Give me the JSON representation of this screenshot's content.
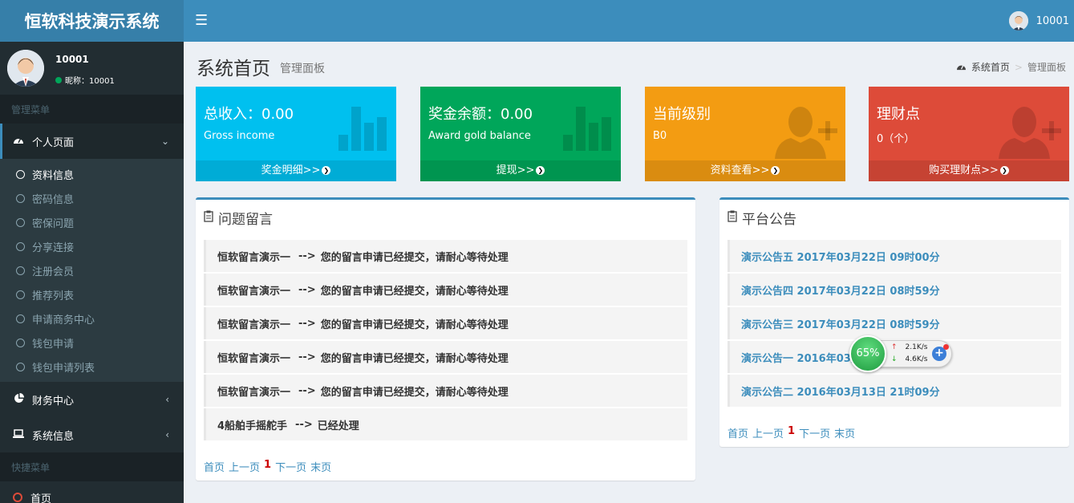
{
  "app": {
    "title": "恒软科技演示系统"
  },
  "topbar": {
    "username": "10001"
  },
  "user_panel": {
    "name": "10001",
    "nickname": "昵称：10001"
  },
  "sidebar": {
    "header_manage": "管理菜单",
    "personal": "个人页面",
    "sub_items": [
      "资料信息",
      "密码信息",
      "密保问题",
      "分享连接",
      "注册会员",
      "推荐列表",
      "申请商务中心",
      "钱包申请",
      "钱包申请列表"
    ],
    "finance": "财务中心",
    "system": "系统信息",
    "header_quick": "快捷菜单",
    "home": "首页"
  },
  "page": {
    "title": "系统首页",
    "subtitle": "管理面板"
  },
  "breadcrumb": {
    "home": "系统首页",
    "current": "管理面板"
  },
  "boxes": [
    {
      "title": "总收入：0.00",
      "sub": "Gross income",
      "link": "奖金明细>>",
      "color": "#00c0ef"
    },
    {
      "title": "奖金余额：0.00",
      "sub": "Award gold balance",
      "link": "提现>>",
      "color": "#00a65a"
    },
    {
      "title": "当前级别",
      "sub": "B0",
      "link": "资料查看>>",
      "color": "#f39c12"
    },
    {
      "title": "理财点",
      "sub": "0（个）",
      "link": "购买理财点>>",
      "color": "#dd4b39"
    }
  ],
  "messages": {
    "title": "问题留言",
    "rows": [
      {
        "name": "恒软留言演示一",
        "arrow": "-->",
        "text": "您的留言申请已经提交，请耐心等待处理"
      },
      {
        "name": "恒软留言演示一",
        "arrow": "-->",
        "text": "您的留言申请已经提交，请耐心等待处理"
      },
      {
        "name": "恒软留言演示一",
        "arrow": "-->",
        "text": "您的留言申请已经提交，请耐心等待处理"
      },
      {
        "name": "恒软留言演示一",
        "arrow": "-->",
        "text": "您的留言申请已经提交，请耐心等待处理"
      },
      {
        "name": "恒软留言演示一",
        "arrow": "-->",
        "text": "您的留言申请已经提交，请耐心等待处理"
      },
      {
        "name": "4船舶手摇舵手",
        "arrow": "-->",
        "text": "已经处理"
      }
    ]
  },
  "notices": {
    "title": "平台公告",
    "rows": [
      "演示公告五 2017年03月22日 09时00分",
      "演示公告四 2017年03月22日 08时59分",
      "演示公告三 2017年03月22日 08时59分",
      "演示公告一 2016年03月",
      "演示公告二 2016年03月13日 21时09分"
    ]
  },
  "pager": {
    "first": "首页",
    "prev": "上一页",
    "current": "1",
    "next": "下一页",
    "last": "末页"
  },
  "widget": {
    "percent": "65%",
    "up": "2.1K/s",
    "down": "4.6K/s"
  }
}
